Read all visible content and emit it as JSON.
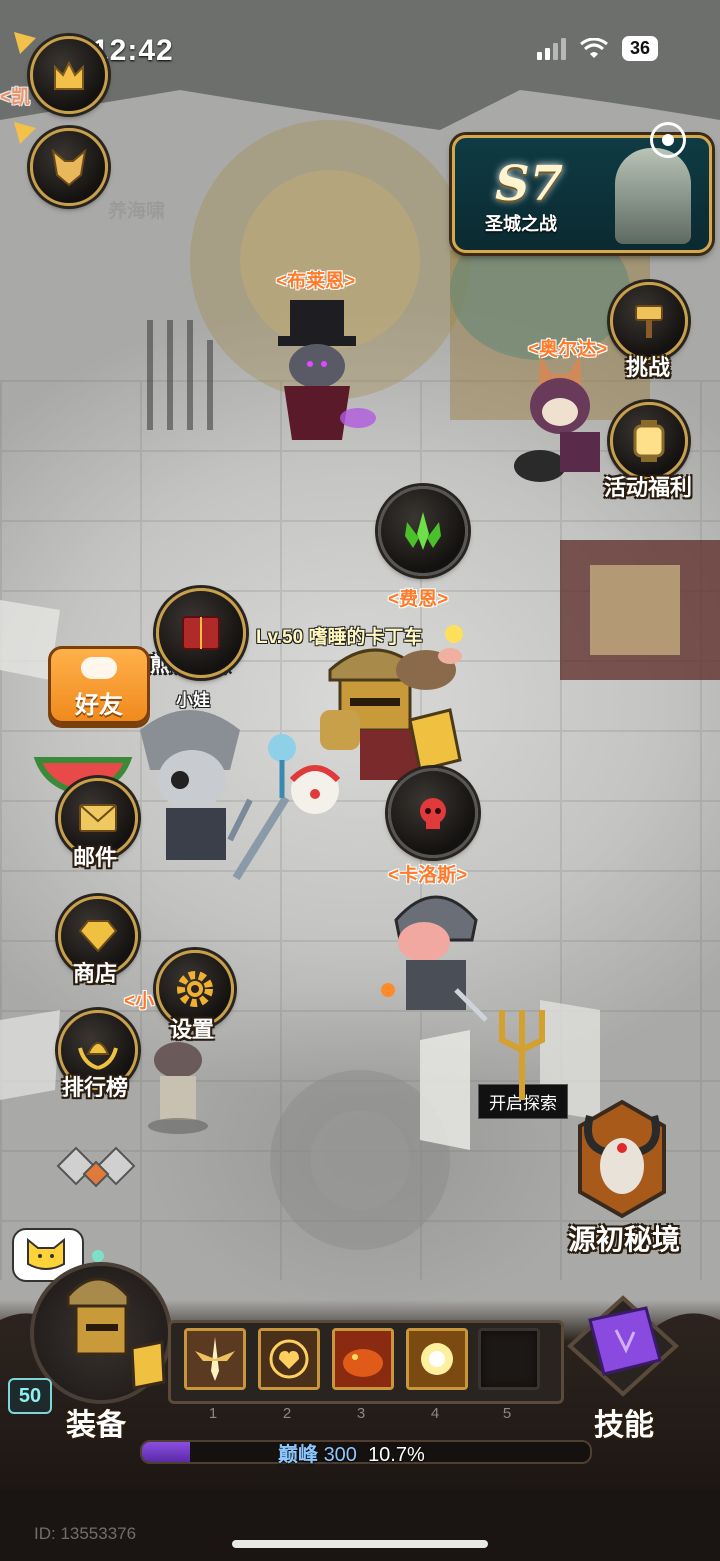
{
  "status_bar": {
    "time": "12:42",
    "battery": "36",
    "icons": [
      "cellular-signal-icon",
      "wifi-icon",
      "battery-icon"
    ]
  },
  "left_top": {
    "buttons": [
      {
        "name": "guild-emblem",
        "icon": "crown-emblem-icon"
      },
      {
        "name": "pet-emblem",
        "icon": "fox-head-icon"
      }
    ],
    "faded_names": [
      "<凯",
      "养海啸"
    ]
  },
  "season_banner": {
    "season": "S7",
    "title": "圣城之战"
  },
  "right_menu": {
    "challenge": "挑战",
    "event_rewards": "活动福利"
  },
  "npcs": {
    "blaine": "<布莱恩>",
    "olda": "<奥尔达>",
    "fein": "<费恩>",
    "carlos": "<卡洛斯>",
    "partial_left": "<小"
  },
  "player": {
    "nameplate": "Lv.50 嗜睡的卡丁车",
    "other_player": "煎饼龙珠",
    "other_player_suffix": "小娃"
  },
  "left_menu": {
    "friends": "好友",
    "mail": "邮件",
    "shop": "商店",
    "settings": "设置",
    "leaderboard": "排行榜"
  },
  "explore_tooltip": "开启探索",
  "dungeon": {
    "label": "源初秘境"
  },
  "bottom": {
    "equipment": "装备",
    "skills": "技能",
    "level": "50",
    "skill_slots": [
      {
        "number": "1",
        "filled": true,
        "icon": "winged-sword-icon"
      },
      {
        "number": "2",
        "filled": true,
        "icon": "golden-heart-icon"
      },
      {
        "number": "3",
        "filled": true,
        "icon": "fire-beast-icon"
      },
      {
        "number": "4",
        "filled": true,
        "icon": "light-burst-icon"
      },
      {
        "number": "5",
        "filled": false,
        "icon": ""
      }
    ],
    "xp": {
      "label": "巅峰",
      "value": "300",
      "percent_text": "10.7%",
      "fill": 0.107
    },
    "player_id": "ID: 13553376"
  },
  "colors": {
    "gold_border": "#c9a04a",
    "npc_name": "#ff7a2a",
    "friends_orange": "#f08a1e",
    "xp_purple": "#7a3fd0",
    "banner_teal": "#0f3b44"
  }
}
